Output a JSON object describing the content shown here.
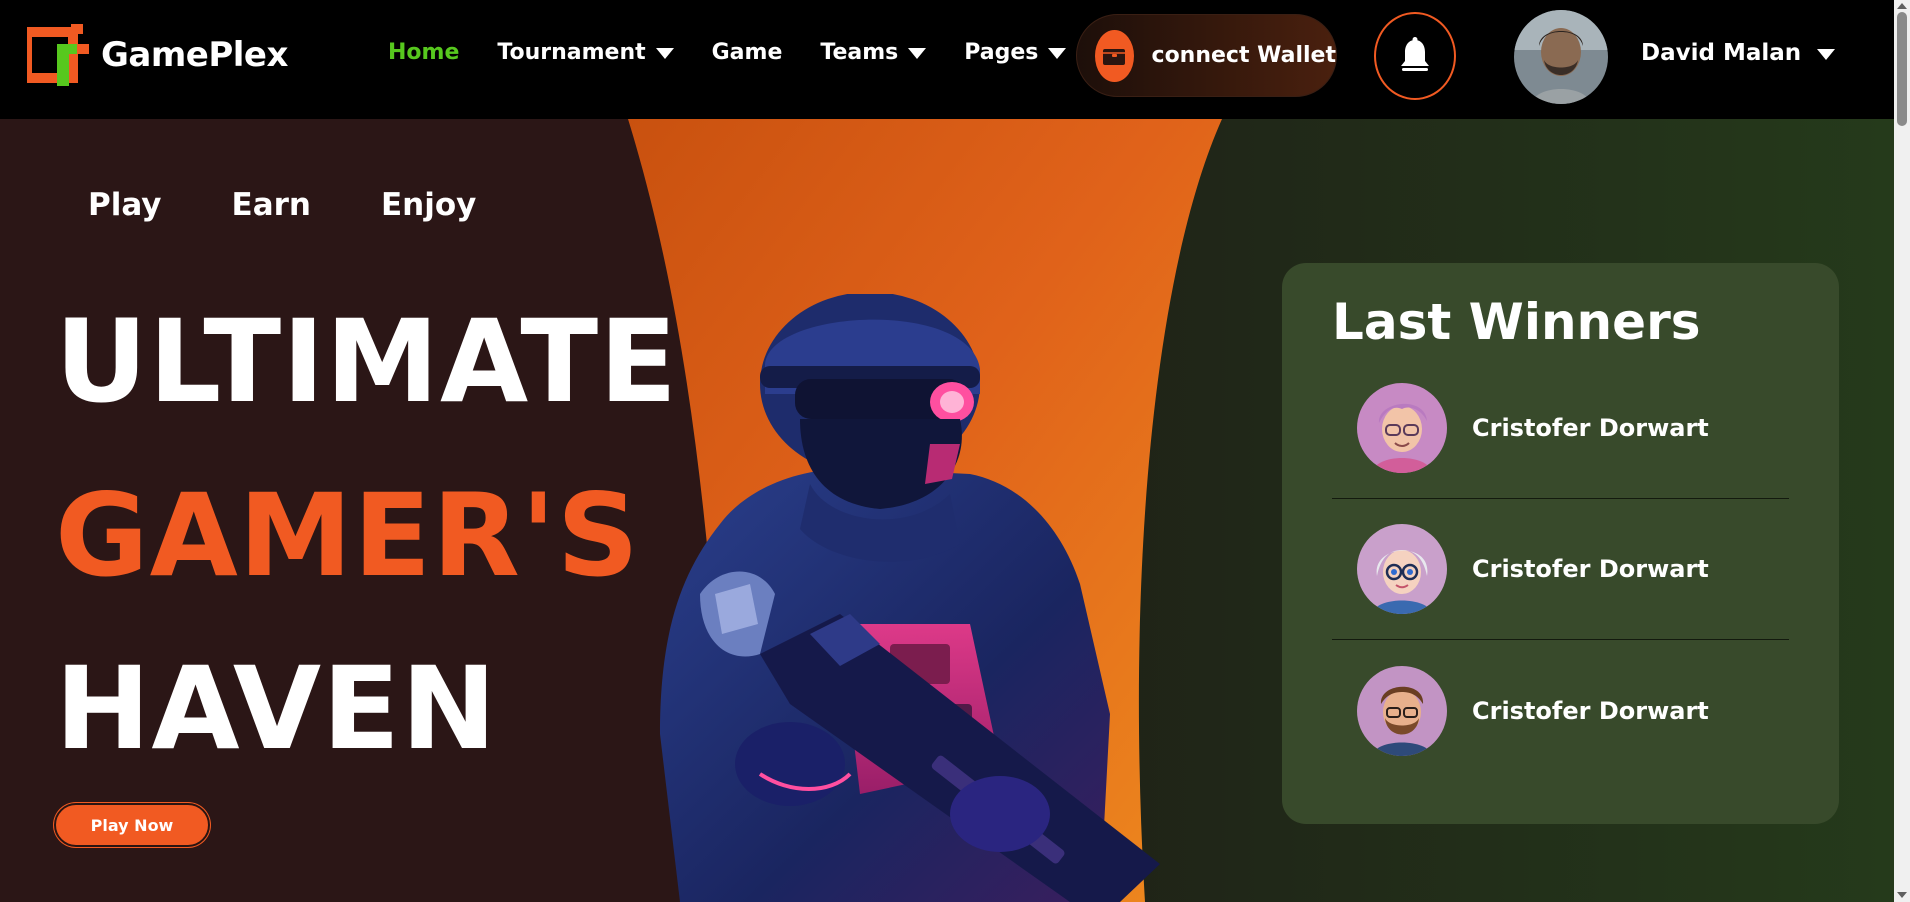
{
  "brand": {
    "name": "GamePlex"
  },
  "nav": {
    "items": [
      {
        "label": "Home",
        "active": true,
        "dropdown": false
      },
      {
        "label": "Tournament",
        "active": false,
        "dropdown": true
      },
      {
        "label": "Game",
        "active": false,
        "dropdown": false
      },
      {
        "label": "Teams",
        "active": false,
        "dropdown": true
      },
      {
        "label": "Pages",
        "active": false,
        "dropdown": true
      }
    ]
  },
  "wallet": {
    "label": "connect Wallet",
    "icon": "wallet-icon"
  },
  "notifications": {
    "icon": "bell-icon"
  },
  "user": {
    "name": "David Malan"
  },
  "hero": {
    "tags": [
      "Play",
      "Earn",
      "Enjoy"
    ],
    "headline": {
      "line1": "ULTIMATE",
      "line2": "GAMER'S",
      "line3": "HAVEN"
    },
    "cta": "Play Now"
  },
  "winners": {
    "title": "Last Winners",
    "list": [
      {
        "name": "Cristofer Dorwart"
      },
      {
        "name": "Cristofer Dorwart"
      },
      {
        "name": "Cristofer Dorwart"
      }
    ]
  },
  "colors": {
    "accent": "#f15a22",
    "active_nav": "#57c81e",
    "hero_left": "#2b1616",
    "hero_right": "#22301a",
    "card": "#384a2b"
  }
}
